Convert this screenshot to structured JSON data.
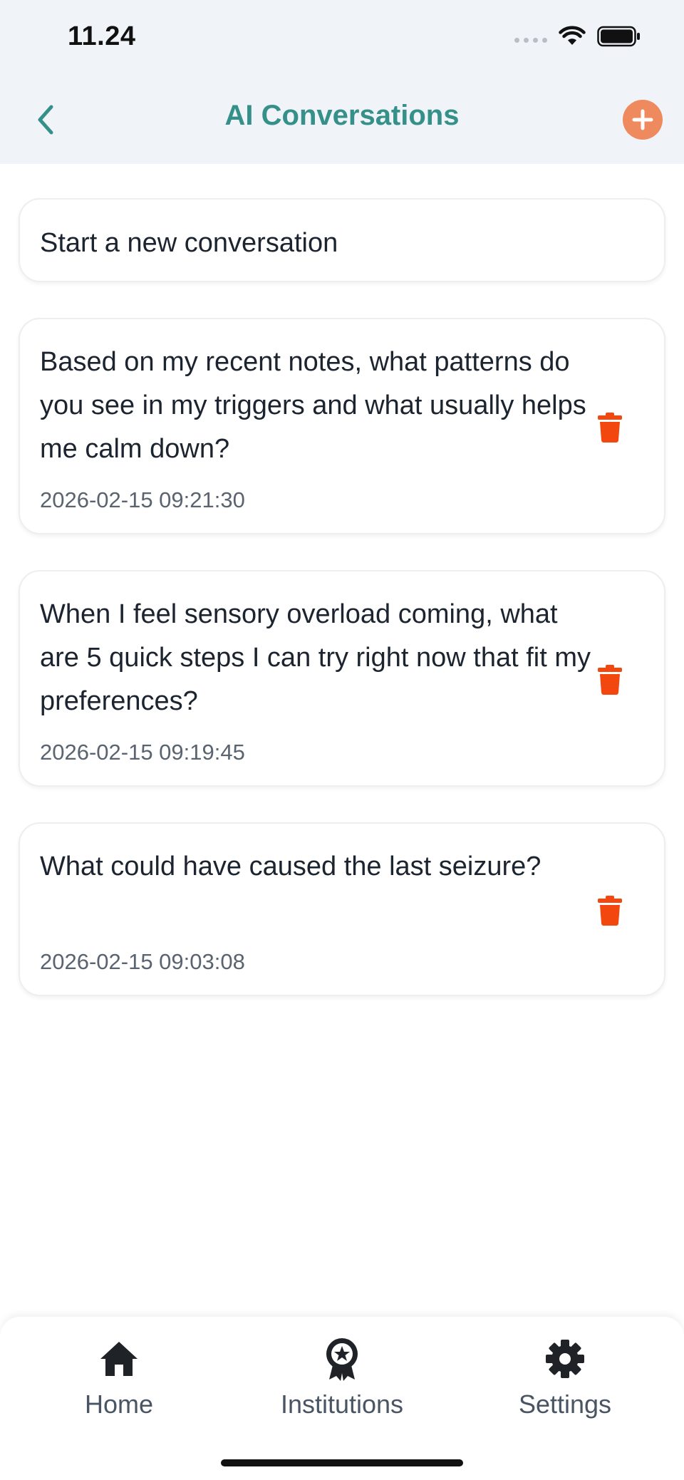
{
  "status_bar": {
    "time": "11.24"
  },
  "header": {
    "title": "AI Conversations",
    "back_icon": "chevron-left-icon",
    "add_icon": "plus-circle-icon",
    "accent_color": "#35908a",
    "add_color": "#ee8a5e"
  },
  "new_conversation": {
    "label": "Start a new conversation"
  },
  "conversations": [
    {
      "text": "Based on my recent notes, what patterns do you see in my triggers and what usually helps me calm down?",
      "timestamp": "2026-02-15 09:21:30"
    },
    {
      "text": "When I feel sensory overload coming, what are 5 quick steps I can try right now that fit my preferences?",
      "timestamp": "2026-02-15 09:19:45"
    },
    {
      "text": "What could have caused the last seizure?",
      "timestamp": "2026-02-15 09:03:08"
    }
  ],
  "delete_color": "#f2470f",
  "tab_bar": {
    "tabs": [
      {
        "label": "Home",
        "icon": "home-icon"
      },
      {
        "label": "Institutions",
        "icon": "award-ribbon-icon"
      },
      {
        "label": "Settings",
        "icon": "gear-icon"
      }
    ]
  }
}
